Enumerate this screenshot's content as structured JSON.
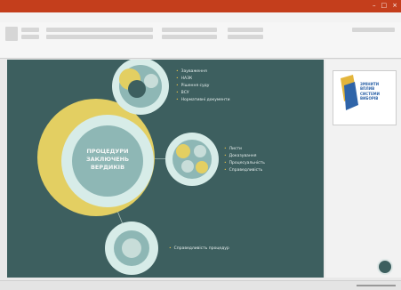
{
  "app": {
    "title": ""
  },
  "tabs": [
    "",
    "",
    "",
    "",
    "",
    "",
    ""
  ],
  "slide": {
    "center_title": "ПРОЦЕДУРИ\nЗАКЛЮЧЕНЬ\nВЕРДИКІВ",
    "top_bullets": [
      "Зауваження",
      "НАЗК",
      "Рішення суду",
      "ВСУ",
      "Нормативні документи"
    ],
    "right_bullets": [
      "Листи",
      "Доказування",
      "Процесуальність",
      "Справедливість"
    ],
    "bottom_text": "Справедливість процедур"
  },
  "side_thumb": {
    "line1": "ЗМІНИТИ",
    "line2": "ВПЛИВ",
    "line3": "СИСТЕМИ",
    "line4": "ВИБОРІВ"
  },
  "statusbar": {
    "left": "",
    "right": ""
  },
  "colors": {
    "accent": "#c43e1c",
    "slide_bg": "#3d5f5f",
    "gold": "#d9b53a",
    "ring": "#d7ece8"
  }
}
